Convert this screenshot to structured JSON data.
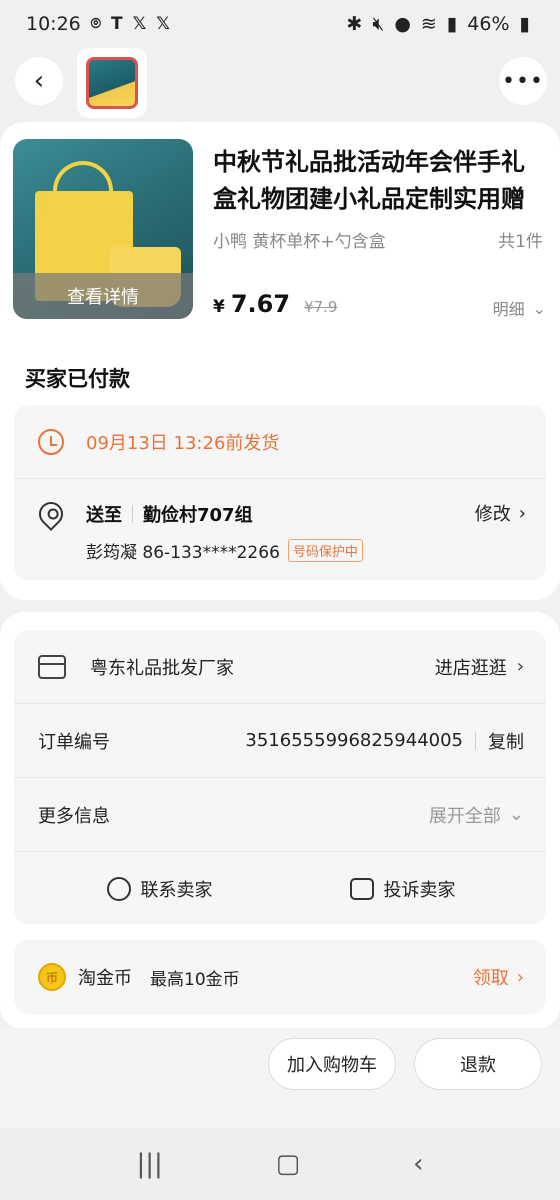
{
  "status_bar": {
    "time": "10:26",
    "left_icons": [
      "voicemail-icon",
      "t-mobile-icon",
      "x-icon",
      "x-icon"
    ],
    "battery": "46%"
  },
  "header": {
    "back_icon": "back-arrow-icon",
    "more_icon": "more-dots-icon"
  },
  "product": {
    "title": "中秋节礼品批活动年会伴手礼盒礼物团建小礼品定制实用赠",
    "spec": "小鸭 黄杯单杯+勺含盒",
    "quantity": "共1件",
    "thumb_overlay": "查看详情",
    "price_symbol": "¥",
    "price": "7.67",
    "original_price": "¥7.9",
    "detail_label": "明细"
  },
  "order_status": "买家已付款",
  "shipping": {
    "deadline": "09月13日 13:26前发货",
    "to_label": "送至",
    "address": "勤俭村707组",
    "modify_label": "修改",
    "recipient": "彭筠凝 86-133****2266",
    "privacy_badge": "号码保护中"
  },
  "store": {
    "name": "粤东礼品批发厂家",
    "visit_label": "进店逛逛"
  },
  "order": {
    "number_label": "订单编号",
    "number": "3516555996825944005",
    "copy_label": "复制",
    "more_label": "更多信息",
    "expand_label": "展开全部"
  },
  "contact": {
    "seller_label": "联系卖家",
    "complain_label": "投诉卖家"
  },
  "coins": {
    "title": "淘金币",
    "subtitle": "最高10金币",
    "claim_label": "领取",
    "coin_glyph": "币"
  },
  "actions": {
    "add_cart": "加入购物车",
    "refund": "退款"
  }
}
